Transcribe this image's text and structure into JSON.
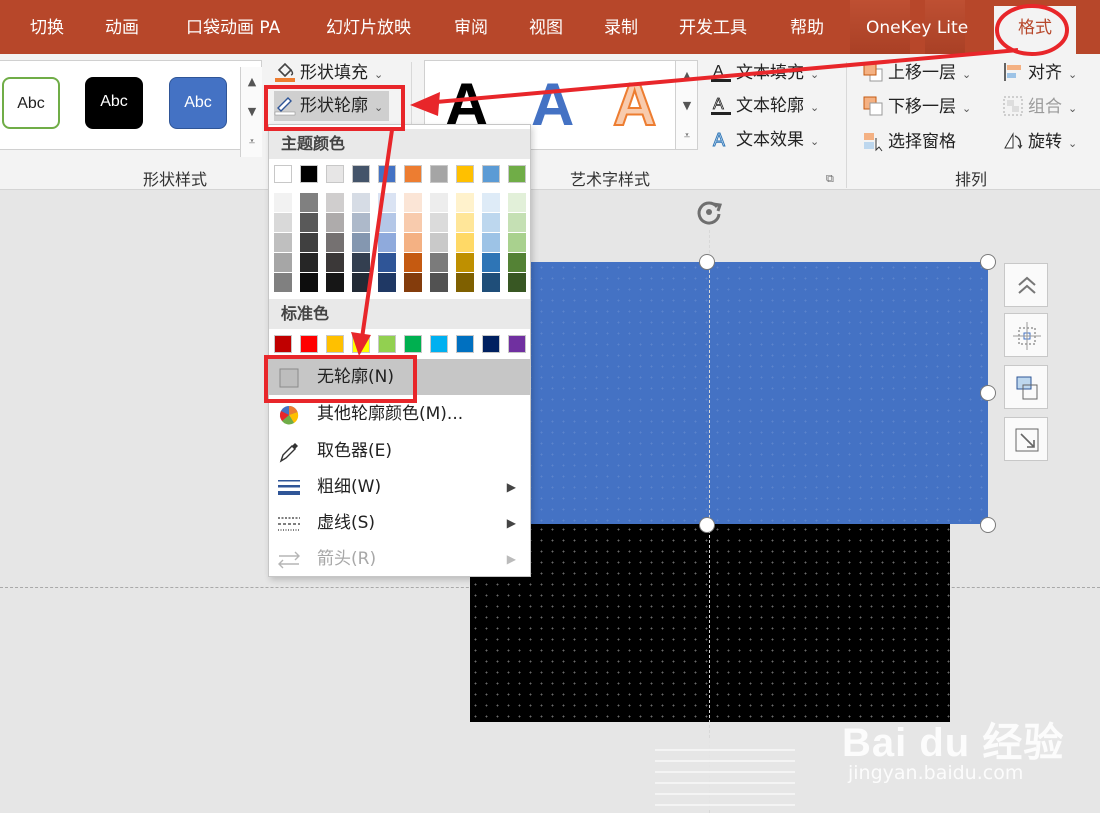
{
  "tabs": [
    "切换",
    "动画",
    "口袋动画 PA",
    "幻灯片放映",
    "审阅",
    "视图",
    "录制",
    "开发工具",
    "帮助",
    "OneKey Lite",
    "格式"
  ],
  "ribbon": {
    "shape_styles": {
      "samples": [
        "Abc",
        "Abc",
        "Abc"
      ],
      "fill": "形状填充",
      "outline": "形状轮廓",
      "label": "形状样式"
    },
    "wordart": {
      "sample": "A",
      "text_fill": "文本填充",
      "text_outline": "文本轮廓",
      "text_effect": "文本效果",
      "label": "艺术字样式"
    },
    "arrange": {
      "bring_forward": "上移一层",
      "send_backward": "下移一层",
      "selection_pane": "选择窗格",
      "align": "对齐",
      "group": "组合",
      "rotate": "旋转",
      "label": "排列"
    }
  },
  "menu": {
    "theme_header": "主题颜色",
    "standard_header": "标准色",
    "theme_top": [
      "#ffffff",
      "#000000",
      "#e7e6e6",
      "#44546a",
      "#4472c4",
      "#ed7d31",
      "#a5a5a5",
      "#ffc000",
      "#5b9bd5",
      "#70ad47"
    ],
    "theme_columns": [
      [
        "#f2f2f2",
        "#d9d9d9",
        "#bfbfbf",
        "#a6a6a6",
        "#808080"
      ],
      [
        "#808080",
        "#595959",
        "#404040",
        "#262626",
        "#0d0d0d"
      ],
      [
        "#d0cece",
        "#aeabab",
        "#757171",
        "#3b3838",
        "#161616"
      ],
      [
        "#d6dce5",
        "#adb9ca",
        "#8497b0",
        "#333f50",
        "#222a35"
      ],
      [
        "#dae3f3",
        "#b4c7e7",
        "#8faadc",
        "#2f5597",
        "#1f3864"
      ],
      [
        "#fbe5d6",
        "#f8cbad",
        "#f4b183",
        "#c55a11",
        "#843c0c"
      ],
      [
        "#ededed",
        "#dbdbdb",
        "#c9c9c9",
        "#7b7b7b",
        "#525252"
      ],
      [
        "#fff2cc",
        "#ffe699",
        "#ffd966",
        "#bf9000",
        "#7f6000"
      ],
      [
        "#deebf7",
        "#bdd7ee",
        "#9dc3e6",
        "#2e75b6",
        "#1f4e79"
      ],
      [
        "#e2f0d9",
        "#c5e0b4",
        "#a9d18e",
        "#548235",
        "#385723"
      ]
    ],
    "standard": [
      "#c00000",
      "#ff0000",
      "#ffc000",
      "#ffff00",
      "#92d050",
      "#00b050",
      "#00b0f0",
      "#0070c0",
      "#002060",
      "#7030a0"
    ],
    "items": {
      "no_outline": "无轮廓(N)",
      "more_colors": "其他轮廓颜色(M)...",
      "eyedropper": "取色器(E)",
      "weight": "粗细(W)",
      "dashes": "虚线(S)",
      "arrows": "箭头(R)"
    }
  },
  "colors": {
    "tabbar": "#b7472a",
    "accent_red": "#e8262a",
    "slide_blue": "#4472c4"
  },
  "watermark": {
    "logo": "Bai du 经验",
    "url": "jingyan.baidu.com"
  }
}
